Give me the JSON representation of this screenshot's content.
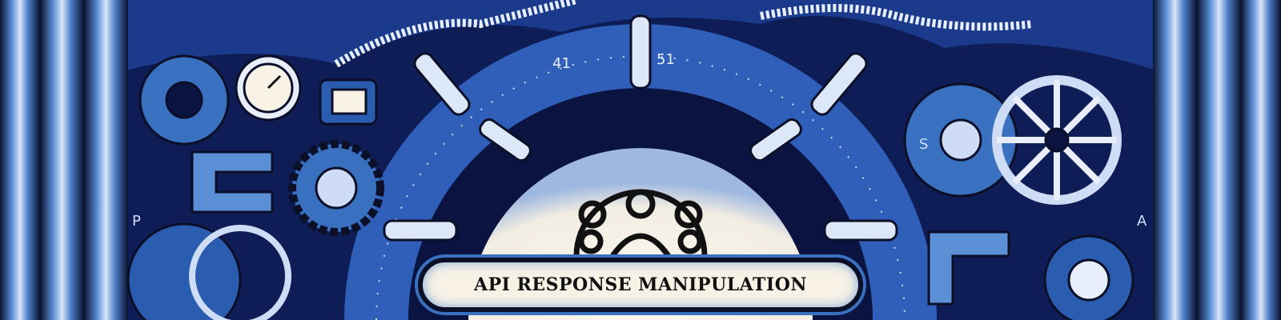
{
  "banner": {
    "title": "API RESPONSE MANIPULATION",
    "dial_labels": [
      "41",
      "51"
    ],
    "side_labels": [
      "P",
      "A",
      "S"
    ]
  },
  "colors": {
    "background": "#0d1a4a",
    "accent_blue": "#3a70c0",
    "plate": "#f7f1e6",
    "ink": "#0b1028"
  }
}
